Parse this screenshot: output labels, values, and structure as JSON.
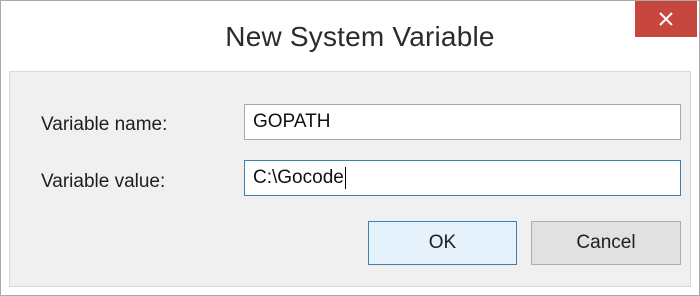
{
  "dialog": {
    "title": "New System Variable",
    "close_icon": "close-icon",
    "close_color": "#c7463e"
  },
  "fields": {
    "name_label": "Variable name:",
    "name_value": "GOPATH",
    "value_label": "Variable value:",
    "value_value": "C:\\Gocode"
  },
  "buttons": {
    "ok_label": "OK",
    "cancel_label": "Cancel"
  },
  "colors": {
    "focus_border": "#3c7fb1",
    "default_button_bg": "#e5f1fb"
  }
}
